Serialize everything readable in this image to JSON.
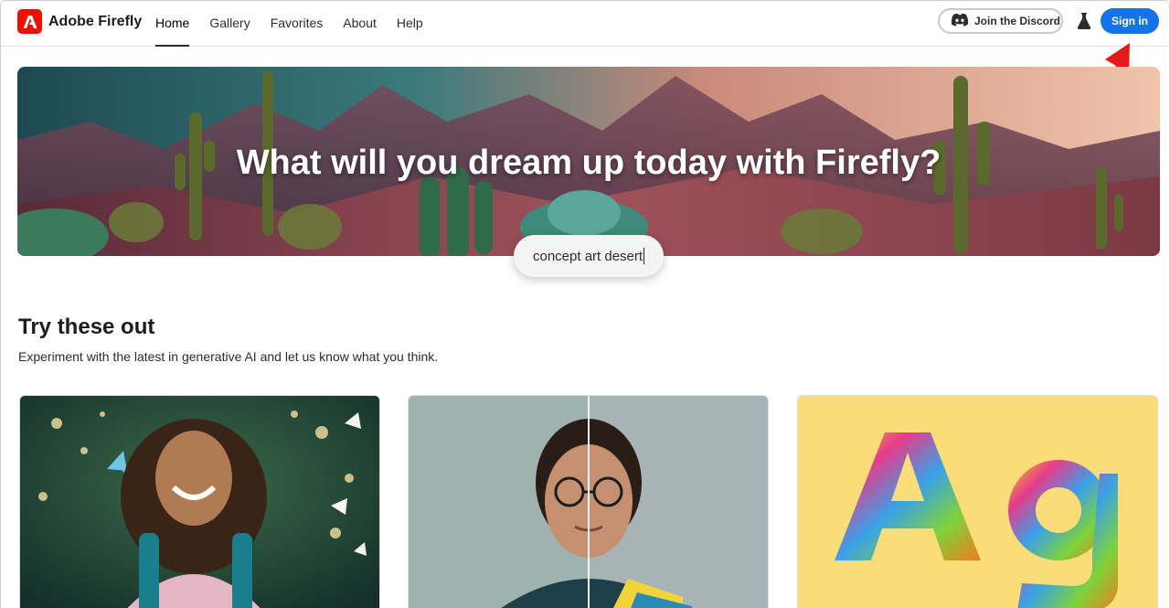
{
  "brand": {
    "name": "Adobe Firefly",
    "color": "#eb1000"
  },
  "nav": {
    "links": [
      {
        "label": "Home",
        "active": true
      },
      {
        "label": "Gallery",
        "active": false
      },
      {
        "label": "Favorites",
        "active": false
      },
      {
        "label": "About",
        "active": false
      },
      {
        "label": "Help",
        "active": false
      }
    ],
    "discord_label": "Join the Discord",
    "signin_label": "Sign in",
    "signin_color": "#1473e6"
  },
  "hero": {
    "title": "What will you dream up today with Firefly?",
    "prompt_value": "concept art desert"
  },
  "try_section": {
    "title": "Try these out",
    "subtitle": "Experiment with the latest in generative AI and let us know what you think."
  },
  "cards": [
    {
      "icon": "girl-butterflies-image"
    },
    {
      "icon": "man-portrait-comparison-image"
    },
    {
      "icon": "furry-text-effect-image"
    }
  ],
  "annotation": {
    "icon": "red-arrow-icon",
    "color": "#e8191b"
  }
}
